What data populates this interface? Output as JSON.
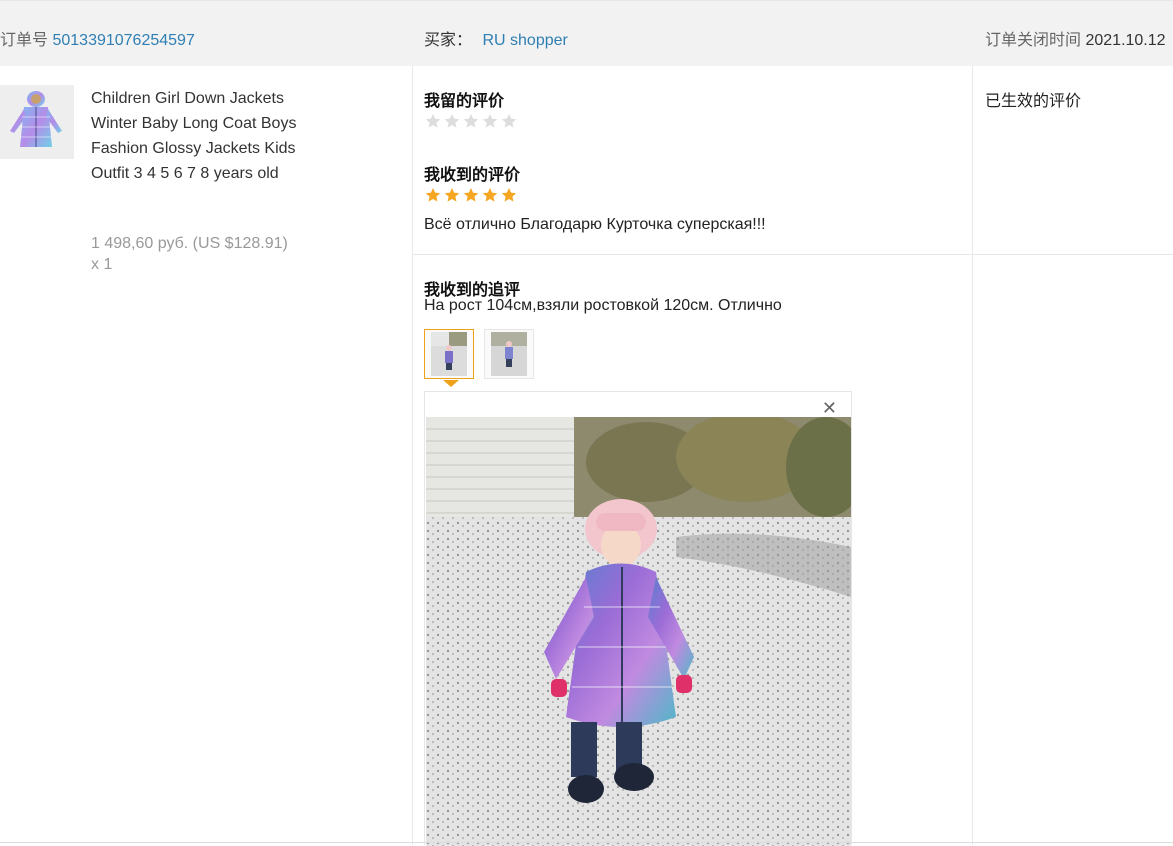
{
  "header": {
    "order_label": "订单号",
    "order_number": "5013391076254597",
    "buyer_label": "买家：",
    "buyer_name": "RU shopper",
    "close_time_label": "订单关闭时间",
    "close_time_value": "2021.10.12"
  },
  "product": {
    "title": "Children Girl Down Jackets Winter Baby Long Coat Boys Fashion Glossy Jackets Kids Outfit 3 4 5 6 7 8 years old",
    "price": "1 498,60 руб. (US $128.91)",
    "quantity": "x 1"
  },
  "my_review": {
    "title": "我留的评价",
    "rating": 0,
    "max_rating": 5
  },
  "received_review": {
    "title": "我收到的评价",
    "rating": 5,
    "max_rating": 5,
    "text": "Всё отлично Благодарю Курточка суперская!!!"
  },
  "effective_review": {
    "label": "已生效的评价"
  },
  "followup_review": {
    "title": "我收到的追评",
    "text": "На рост 104см,взяли ростовкой 120см. Отлично",
    "thumbnails": [
      "photo-1",
      "photo-2"
    ],
    "selected_index": 0
  },
  "colors": {
    "link": "#2f7fb4",
    "star_active": "#f5a623",
    "star_inactive": "#dddddd",
    "thumb_active_border": "#f0a11a"
  },
  "icons": {
    "close": "close-icon",
    "star": "star-icon"
  }
}
